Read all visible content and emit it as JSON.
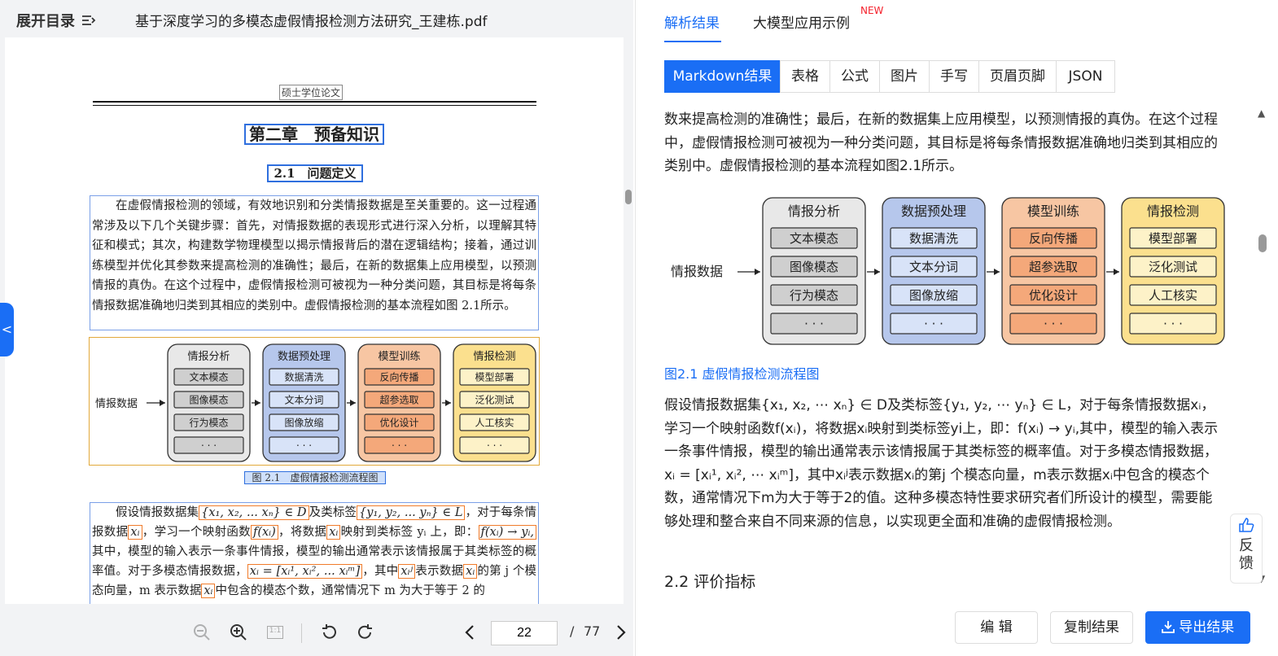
{
  "left": {
    "toc_label": "展开目录",
    "file_name": "基于深度学习的多模态虚假情报检测方法研究_王建栋.pdf",
    "page_header": "硕士学位论文",
    "chapter_title": "第二章　预备知识",
    "section_title": "2.1　问题定义",
    "paragraph1": "在虚假情报检测的领域，有效地识别和分类情报数据是至关重要的。这一过程通常涉及以下几个关键步骤：首先，对情报数据的表现形式进行深入分析，以理解其特征和模式；其次，构建数学物理模型以揭示情报背后的潜在逻辑结构；接着，通过训练模型并优化其参数来提高检测的准确性；最后，在新的数据集上应用模型，以预测情报的真伪。在这个过程中，虚假情报检测可被视为一种分类问题，其目标是将每条情报数据准确地归类到其相应的类别中。虚假情报检测的基本流程如图 2.1所示。",
    "figure_caption": "图 2.1　虚假情报检测流程图",
    "p2_t1": "假设情报数据集",
    "p2_m1": "{x₁, x₂, ... xₙ} ∈ D",
    "p2_t2": "及类标签",
    "p2_m2": "{y₁, y₂, ... yₙ} ∈ L",
    "p2_t3": "，对于每条情报数据",
    "p2_m3": "xᵢ",
    "p2_t4": "，学习一个映射函数",
    "p2_m4": "f(xᵢ)",
    "p2_t5": "，将数据",
    "p2_m5": "xᵢ",
    "p2_t6": "映射到类标签 yᵢ 上，即：",
    "p2_m6": "f(xᵢ) → yᵢ,",
    "p2_t7": "其中，模型的输入表示一条事件情报，模型的输出通常表示该情报属于其类标签的概率值。对于多模态情报数据，",
    "p2_m7": "xᵢ = [xᵢ¹, xᵢ², ... xᵢᵐ]",
    "p2_t8": "，其中",
    "p2_m8": "xᵢʲ",
    "p2_t9": "表示数据",
    "p2_m9": "xᵢ",
    "p2_t10": "的第 j 个模态向量，m 表示数据",
    "p2_m10": "xᵢ",
    "p2_t11": "中包含的模态个数，通常情况下 m 为大于等于 2 的",
    "page_current": "22",
    "page_sep": "/",
    "page_total": "77",
    "fit_icon": "1:1"
  },
  "flow": {
    "input": "情报数据",
    "columns": [
      {
        "title": "情报分析",
        "items": [
          "文本模态",
          "图像模态",
          "行为模态",
          "·  ·  ·"
        ],
        "bg": "#e8e8e8",
        "item_bg": "#cfcfcf"
      },
      {
        "title": "数据预处理",
        "items": [
          "数据清洗",
          "文本分词",
          "图像放缩",
          "·  ·  ·"
        ],
        "bg": "#b6c7ec",
        "item_bg": "#d8e3f8"
      },
      {
        "title": "模型训练",
        "items": [
          "反向传播",
          "超参选取",
          "优化设计",
          "·  ·  ·"
        ],
        "bg": "#f7c6a3",
        "item_bg": "#f4a87a"
      },
      {
        "title": "情报检测",
        "items": [
          "模型部署",
          "泛化测试",
          "人工核实",
          "·  ·  ·"
        ],
        "bg": "#fbe08e",
        "item_bg": "#fdf2c8"
      }
    ]
  },
  "right": {
    "tab_parse": "解析结果",
    "tab_examples": "大模型应用示例",
    "new_badge": "NEW",
    "segments": [
      "Markdown结果",
      "表格",
      "公式",
      "图片",
      "手写",
      "页眉页脚",
      "JSON"
    ],
    "text1": "数来提高检测的准确性；最后，在新的数据集上应用模型，以预测情报的真伪。在这个过程中，虚假情报检测可被视为一种分类问题，其目标是将每条情报数据准确地归类到其相应的类别中。虚假情报检测的基本流程如图2.1所示。",
    "figure_caption": "图2.1 虚假情报检测流程图",
    "text2": "假设情报数据集{x₁, x₂, ⋯ xₙ} ∈ D及类标签{y₁, y₂, ⋯ yₙ} ∈ L，对于每条情报数据xᵢ，学习一个映射函数f(xᵢ)，将数据xᵢ映射到类标签yi上，即：f(xᵢ) → yᵢ,其中，模型的输入表示一条事件情报，模型的输出通常表示该情报属于其类标签的概率值。对于多模态情报数据，  xᵢ = [xᵢ¹, xᵢ², ⋯ xᵢᵐ]，其中xᵢʲ表示数据xᵢ的第j 个模态向量，m表示数据xᵢ中包含的模态个数，通常情况下m为大于等于2的值。这种多模态特性要求研究者们所设计的模型，需要能够处理和整合来自不同来源的信息，以实现更全面和准确的虚假情报检测。",
    "heading_22": "2.2 评价指标",
    "btn_edit": "编 辑",
    "btn_copy": "复制结果",
    "btn_export": "导出结果",
    "feedback": "反馈"
  },
  "colors": {
    "accent": "#1a6ef5",
    "box_blue": "#2f6fde",
    "box_orange": "#f07b2a",
    "new_red": "#f5222d"
  }
}
